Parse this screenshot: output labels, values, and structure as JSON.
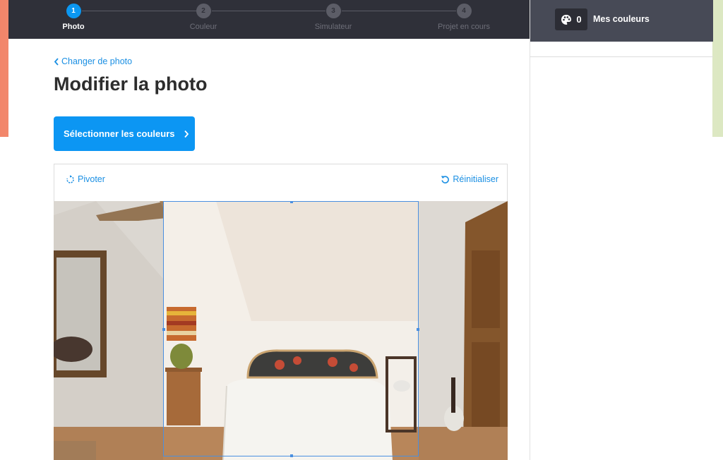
{
  "stepper": {
    "steps": [
      {
        "number": "1",
        "label": "Photo",
        "active": true
      },
      {
        "number": "2",
        "label": "Couleur",
        "active": false
      },
      {
        "number": "3",
        "label": "Simulateur",
        "active": false
      },
      {
        "number": "4",
        "label": "Projet en cours",
        "active": false
      }
    ]
  },
  "main": {
    "back_link": "Changer de photo",
    "title": "Modifier la photo",
    "primary_button": "Sélectionner les couleurs"
  },
  "editor": {
    "rotate_label": "Pivoter",
    "reset_label": "Réinitialiser"
  },
  "side_panel": {
    "color_count": "0",
    "title": "Mes couleurs"
  },
  "icons": {
    "back": "chevron-left-icon",
    "button": "chevron-right-icon",
    "rotate": "rotate-icon",
    "reset": "reset-icon",
    "palette": "palette-icon"
  },
  "colors": {
    "accent": "#0c96f3",
    "link": "#1a8fe3",
    "stepper_bg": "#2f3039",
    "side_header_bg": "#474a56"
  }
}
